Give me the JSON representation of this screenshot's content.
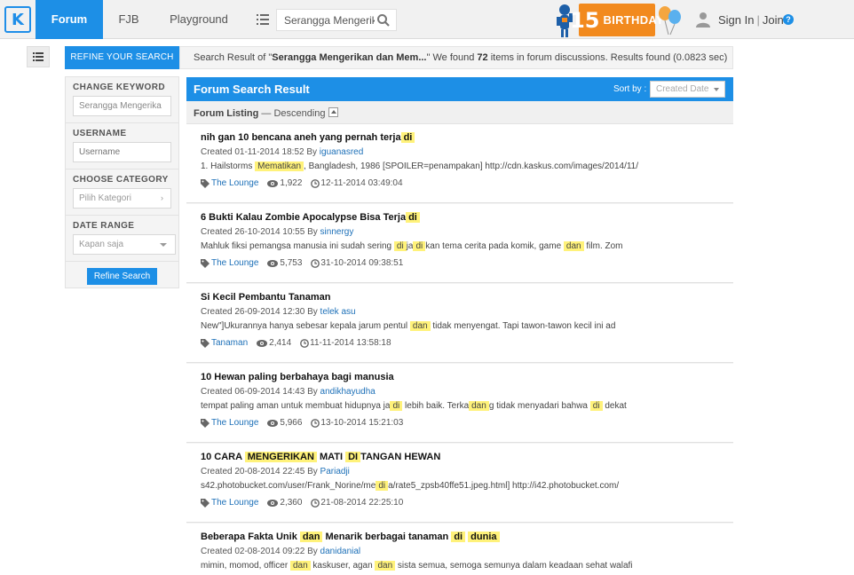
{
  "nav": {
    "tabs": [
      "Forum",
      "FJB",
      "Playground"
    ],
    "search_value": "Serangga Mengerika",
    "birthday_number": "15",
    "birthday_text": "BIRTHDAY",
    "signin": "Sign In",
    "join": "Join",
    "separator": "|"
  },
  "refine": {
    "tab_label": "REFINE YOUR SEARCH",
    "change_keyword_label": "CHANGE KEYWORD",
    "keyword_value": "Serangga Mengerika",
    "username_label": "USERNAME",
    "username_placeholder": "Username",
    "category_label": "CHOOSE CATEGORY",
    "category_value": "Pilih Kategori",
    "date_label": "DATE RANGE",
    "date_value": "Kapan saja",
    "button": "Refine Search"
  },
  "summary": {
    "prefix": "Search Result of \"",
    "query": "Serangga Mengerikan dan Mem...",
    "mid": "\" We found ",
    "count": "72",
    "suffix": " items in forum discussions. Results found (0.0823 sec)"
  },
  "results_header": {
    "title": "Forum Search Result",
    "sort_label": "Sort by :",
    "sort_value": "Created Date"
  },
  "listing": {
    "label": "Forum Listing",
    "order": " — Descending"
  },
  "results": [
    {
      "title": [
        {
          "t": "nih gan 10 bencana aneh yang pernah terja"
        },
        {
          "t": "di",
          "h": true
        }
      ],
      "created": "Created 01-11-2014 18:52 By ",
      "author": "iguanasred",
      "snippet": [
        {
          "t": "1. Hailstorms "
        },
        {
          "t": "Mematikan",
          "h": true
        },
        {
          "t": ", Bangladesh, 1986 [SPOILER=penampakan] http://cdn.kaskus.com/images/2014/11/"
        }
      ],
      "category": "The Lounge",
      "views": "1,922",
      "last": "12-11-2014 03:49:04"
    },
    {
      "title": [
        {
          "t": "6 Bukti Kalau Zombie Apocalypse Bisa Terja"
        },
        {
          "t": "di",
          "h": true
        }
      ],
      "created": "Created 26-10-2014 10:55 By ",
      "author": "sinnergy",
      "snippet": [
        {
          "t": "Mahluk fiksi pemangsa manusia ini sudah sering "
        },
        {
          "t": "di",
          "h": true
        },
        {
          "t": "ja"
        },
        {
          "t": "di",
          "h": true
        },
        {
          "t": "kan tema cerita pada komik, game "
        },
        {
          "t": "dan",
          "h": true
        },
        {
          "t": " film. Zom"
        }
      ],
      "category": "The Lounge",
      "views": "5,753",
      "last": "31-10-2014 09:38:51"
    },
    {
      "title": [
        {
          "t": "Si Kecil Pembantu Tanaman"
        }
      ],
      "created": "Created 26-09-2014 12:30 By ",
      "author": "telek asu",
      "snippet": [
        {
          "t": "New\"]Ukurannya hanya sebesar kepala jarum pentul "
        },
        {
          "t": "dan",
          "h": true
        },
        {
          "t": " tidak menyengat. Tapi tawon-tawon kecil ini ad"
        }
      ],
      "category": "Tanaman",
      "views": "2,414",
      "last": "11-11-2014 13:58:18"
    },
    {
      "title": [
        {
          "t": "10 Hewan paling berbahaya bagi manusia"
        }
      ],
      "created": "Created 06-09-2014 14:43 By ",
      "author": "andikhayudha",
      "snippet": [
        {
          "t": "tempat paling aman untuk membuat hidupnya ja"
        },
        {
          "t": "di",
          "h": true
        },
        {
          "t": " lebih baik. Terka"
        },
        {
          "t": "dan",
          "h": true
        },
        {
          "t": "g tidak menyadari bahwa "
        },
        {
          "t": "di",
          "h": true
        },
        {
          "t": " dekat"
        }
      ],
      "category": "The Lounge",
      "views": "5,966",
      "last": "13-10-2014 15:21:03"
    },
    {
      "title": [
        {
          "t": "10 CARA "
        },
        {
          "t": "MENGERIKAN",
          "h": true
        },
        {
          "t": " MATI "
        },
        {
          "t": "DI",
          "h": true
        },
        {
          "t": "TANGAN HEWAN"
        }
      ],
      "created": "Created 20-08-2014 22:45 By ",
      "author": "Pariadji",
      "snippet": [
        {
          "t": "s42.photobucket.com/user/Frank_Norine/me"
        },
        {
          "t": "di",
          "h": true
        },
        {
          "t": "a/rate5_zpsb40ffe51.jpeg.html] http://i42.photobucket.com/"
        }
      ],
      "category": "The Lounge",
      "views": "2,360",
      "last": "21-08-2014 22:25:10"
    },
    {
      "title": [
        {
          "t": "Beberapa Fakta Unik "
        },
        {
          "t": "dan",
          "h": true
        },
        {
          "t": " Menarik berbagai tanaman "
        },
        {
          "t": "di",
          "h": true
        },
        {
          "t": " "
        },
        {
          "t": "dunia",
          "h": true
        }
      ],
      "created": "Created 02-08-2014 09:22 By ",
      "author": "danidanial",
      "snippet": [
        {
          "t": "mimin, momod, officer "
        },
        {
          "t": "dan",
          "h": true
        },
        {
          "t": " kaskuser, agan "
        },
        {
          "t": "dan",
          "h": true
        },
        {
          "t": " sista semua, semoga semunya dalam keadaan sehat walafi"
        }
      ],
      "category": "",
      "views": "",
      "last": ""
    }
  ],
  "colors": {
    "primary": "#1d8fe6",
    "highlight": "#fff27a",
    "birthday": "#f28a1e"
  }
}
